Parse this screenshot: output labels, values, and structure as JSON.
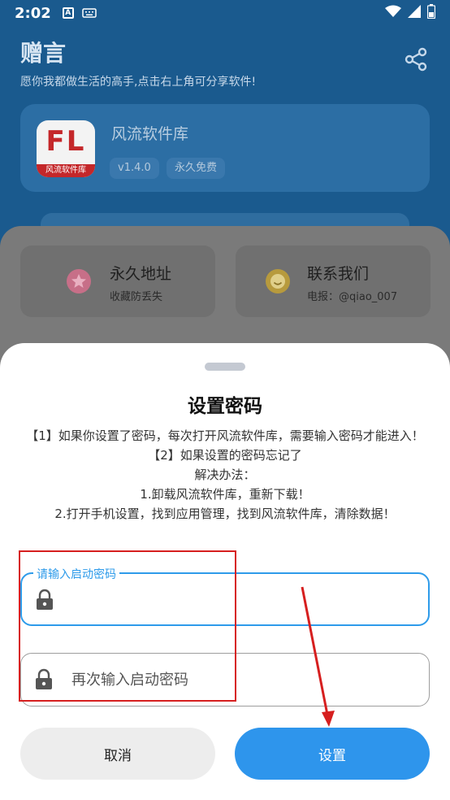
{
  "status_bar": {
    "time": "2:02",
    "icon_a": "A"
  },
  "header": {
    "title": "赠言",
    "subtitle": "愿你我都做生活的高手,点击右上角可分享软件!"
  },
  "app": {
    "name": "风流软件库",
    "logo_text": "FL",
    "logo_band": "风流软件库",
    "version": "v1.4.0",
    "tag": "永久免费"
  },
  "features": [
    {
      "title": "永久地址",
      "subtitle": "收藏防丢失",
      "icon": "star-badge-icon",
      "color": "#e77d9b"
    },
    {
      "title": "联系我们",
      "subtitle": "电报：@qiao_007",
      "icon": "smile-badge-icon",
      "color": "#e8c34a"
    }
  ],
  "dialog": {
    "title": "设置密码",
    "instructions": [
      "【1】如果你设置了密码，每次打开风流软件库，需要输入密码才能进入！",
      "【2】如果设置的密码忘记了",
      "解决办法：",
      "1.卸载风流软件库，重新下载！",
      "2.打开手机设置，找到应用管理，找到风流软件库，清除数据！"
    ],
    "password_label": "请输入启动密码",
    "confirm_placeholder": "再次输入启动密码",
    "cancel_label": "取消",
    "confirm_label": "设置"
  },
  "colors": {
    "accent": "#2e95ec",
    "annotation": "#d61f1f"
  }
}
